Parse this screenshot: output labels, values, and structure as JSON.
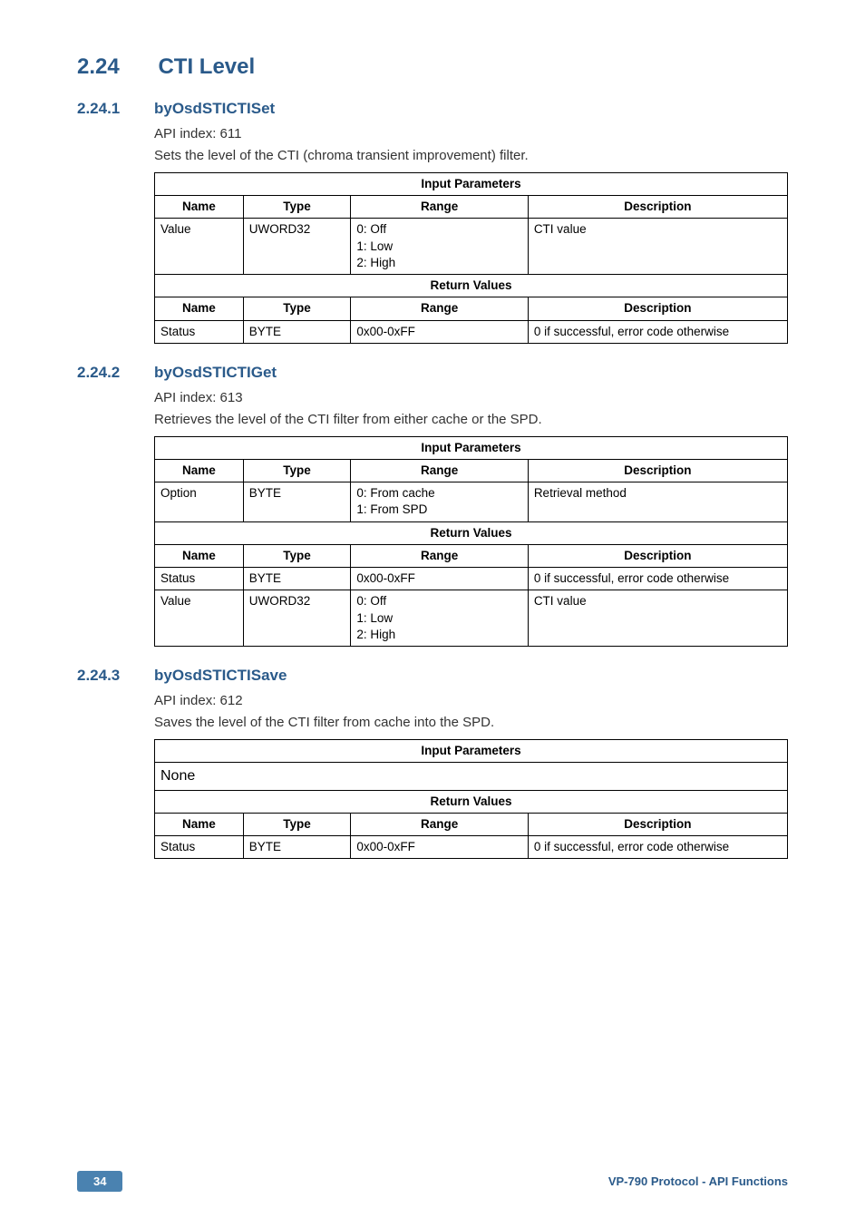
{
  "section": {
    "num": "2.24",
    "title": "CTI Level"
  },
  "subsections": [
    {
      "num": "2.24.1",
      "title": "byOsdSTICTISet",
      "api": "API index: 611",
      "desc": "Sets the level of the CTI (chroma transient improvement) filter.",
      "tables": {
        "input_heading": "Input Parameters",
        "return_heading": "Return Values",
        "col_headers": [
          "Name",
          "Type",
          "Range",
          "Description"
        ],
        "input_rows": [
          [
            "Value",
            "UWORD32",
            "0: Off\n1: Low\n2: High",
            "CTI value"
          ]
        ],
        "return_rows": [
          [
            "Status",
            "BYTE",
            "0x00-0xFF",
            "0 if successful, error code otherwise"
          ]
        ]
      }
    },
    {
      "num": "2.24.2",
      "title": "byOsdSTICTIGet",
      "api": "API index: 613",
      "desc": "Retrieves the level of the CTI filter from either cache or the SPD.",
      "tables": {
        "input_heading": "Input Parameters",
        "return_heading": "Return Values",
        "col_headers": [
          "Name",
          "Type",
          "Range",
          "Description"
        ],
        "input_rows": [
          [
            "Option",
            "BYTE",
            "0: From cache\n1: From SPD",
            "Retrieval method"
          ]
        ],
        "return_rows": [
          [
            "Status",
            "BYTE",
            "0x00-0xFF",
            "0 if successful, error code otherwise"
          ],
          [
            "Value",
            "UWORD32",
            "0: Off\n1: Low\n2: High",
            "CTI value"
          ]
        ]
      }
    },
    {
      "num": "2.24.3",
      "title": "byOsdSTICTISave",
      "api": "API index: 612",
      "desc": "Saves the level of the CTI filter from cache into the SPD.",
      "tables": {
        "input_heading": "Input Parameters",
        "return_heading": "Return Values",
        "col_headers": [
          "Name",
          "Type",
          "Range",
          "Description"
        ],
        "none_label": "None",
        "return_rows": [
          [
            "Status",
            "BYTE",
            "0x00-0xFF",
            "0 if successful, error code otherwise"
          ]
        ]
      }
    }
  ],
  "footer": {
    "page": "34",
    "doc": "VP-790 Protocol - API Functions"
  }
}
